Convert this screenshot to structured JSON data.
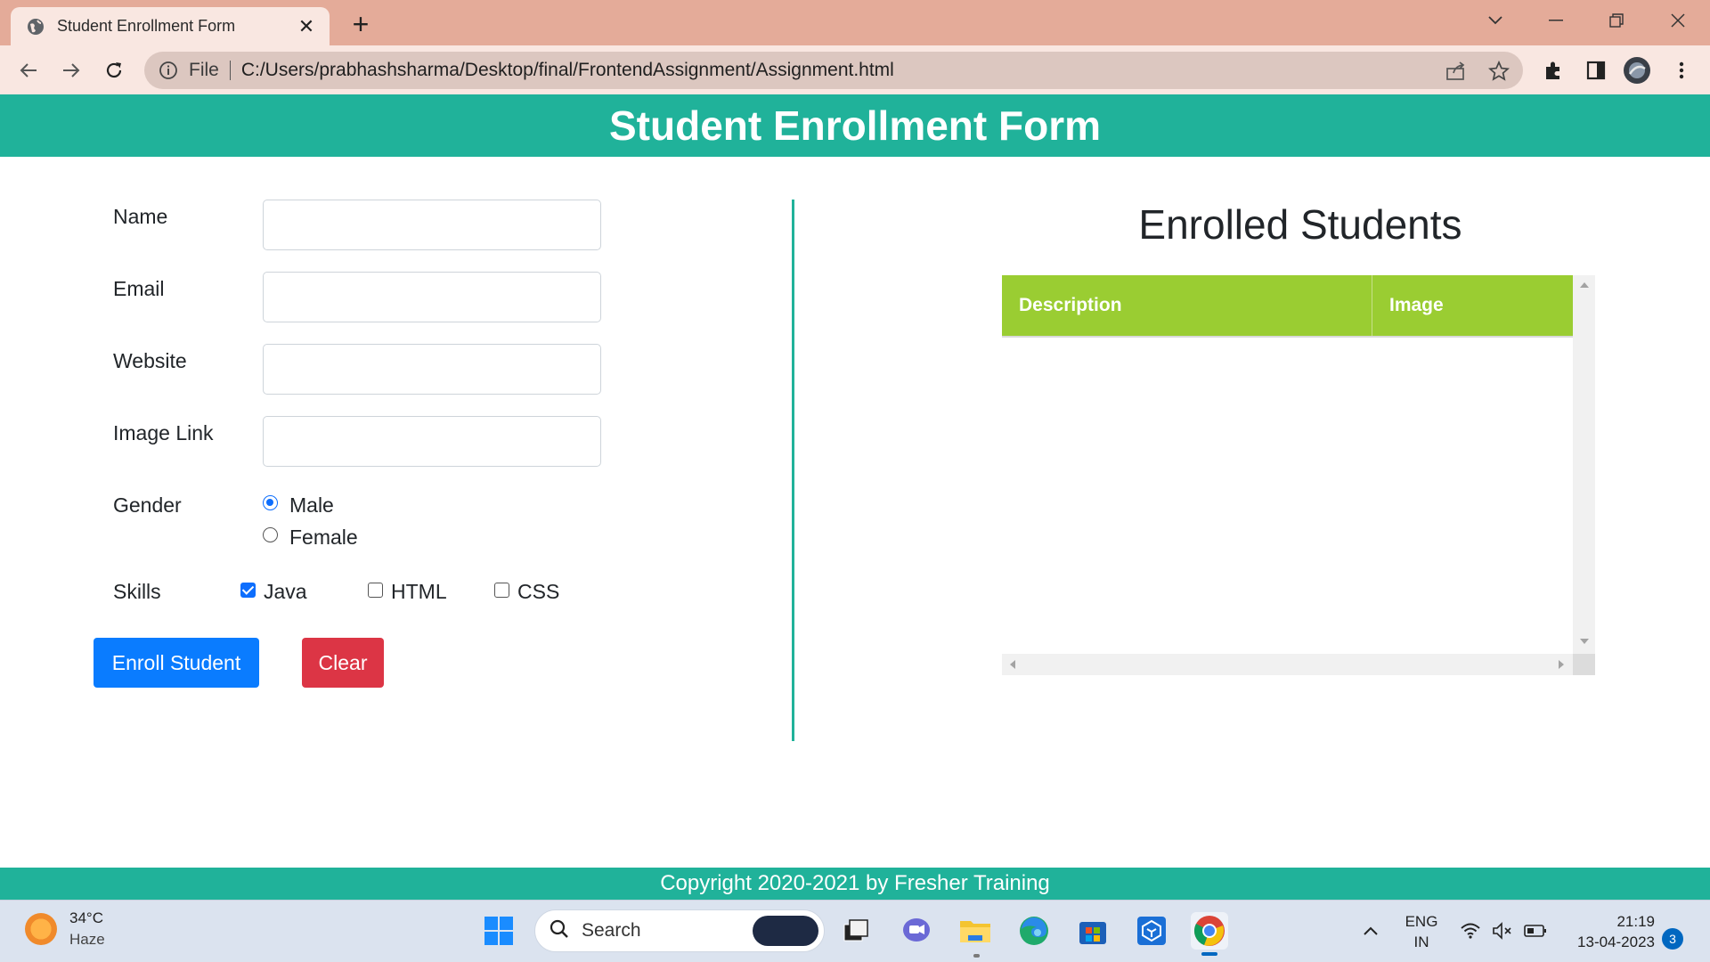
{
  "browser": {
    "tab_title": "Student Enrollment Form",
    "tab_close": "✕",
    "new_tab": "+",
    "scheme_label": "File",
    "url": "C:/Users/prabhashsharma/Desktop/final/FrontendAssignment/Assignment.html"
  },
  "page": {
    "header_title": "Student Enrollment Form",
    "footer_text": "Copyright 2020-2021 by Fresher Training"
  },
  "form": {
    "name_label": "Name",
    "name_value": "",
    "email_label": "Email",
    "email_value": "",
    "website_label": "Website",
    "website_value": "",
    "image_label": "Image Link",
    "image_value": "",
    "gender_label": "Gender",
    "gender_options": [
      {
        "label": "Male",
        "checked": true
      },
      {
        "label": "Female",
        "checked": false
      }
    ],
    "skills_label": "Skills",
    "skills_options": [
      {
        "label": "Java",
        "checked": true
      },
      {
        "label": "HTML",
        "checked": false
      },
      {
        "label": "CSS",
        "checked": false
      }
    ],
    "enroll_button": "Enroll Student",
    "clear_button": "Clear"
  },
  "enrolled": {
    "title": "Enrolled Students",
    "columns": [
      "Description",
      "Image"
    ],
    "rows": []
  },
  "taskbar": {
    "weather_temp": "34°C",
    "weather_condition": "Haze",
    "search_label": "Search",
    "language_line1": "ENG",
    "language_line2": "IN",
    "time": "21:19",
    "date": "13-04-2023",
    "notification_count": "3"
  },
  "colors": {
    "theme": "#20b29a",
    "table_header": "#9acd32",
    "enroll_button": "#0a7cff",
    "clear_button": "#dc3545",
    "tab_strip": "#e4ab99"
  },
  "icons": {
    "favicon": "globe-icon",
    "back": "arrow-left-icon",
    "forward": "arrow-right-icon",
    "reload": "reload-icon",
    "info": "info-icon",
    "share": "share-icon",
    "bookmark": "star-icon",
    "extensions": "puzzle-icon",
    "side_panel": "side-panel-icon",
    "profile": "avatar",
    "menu": "kebab-menu-icon"
  }
}
